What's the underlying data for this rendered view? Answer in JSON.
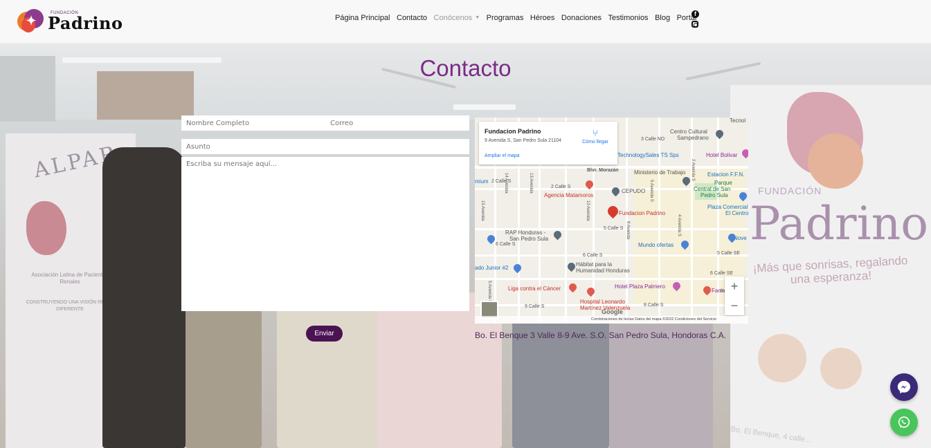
{
  "brand": {
    "small": "FUNDACIÓN",
    "name": "Padrino"
  },
  "nav": {
    "items": [
      {
        "label": "Página Principal",
        "muted": false
      },
      {
        "label": "Contacto",
        "muted": false
      },
      {
        "label": "Conócenos",
        "muted": true,
        "dropdown": true
      },
      {
        "label": "Programas",
        "muted": false
      },
      {
        "label": "Héroes",
        "muted": false
      },
      {
        "label": "Donaciones",
        "muted": false
      },
      {
        "label": "Testimonios",
        "muted": false
      },
      {
        "label": "Blog",
        "muted": false
      },
      {
        "label": "Portal",
        "muted": false
      }
    ],
    "social_icons": [
      "facebook-icon",
      "instagram-icon"
    ]
  },
  "page": {
    "title": "Contacto"
  },
  "form": {
    "name_placeholder": "Nombre Completo",
    "email_placeholder": "Correo",
    "subject_placeholder": "Asunto",
    "message_placeholder": "Escriba su mensaje aquí...",
    "submit_label": "Enviar"
  },
  "map": {
    "place_name": "Fundacion Padrino",
    "place_address": "9 Avenida S, San Pedro Sula 21104",
    "directions_label": "Cómo llegar",
    "enlarge_label": "Ampliar el mapa",
    "labels": {
      "tecnol": "Tecnol",
      "centro": "Centro Cultural",
      "sampedrano": "Sampedrano",
      "calle3": "3 Calle NO",
      "technology": "TechnologySales TS Sps",
      "hotel_bolivar": "Hotel Bolivar",
      "morazan": "Blvr. Morazán",
      "ministerio": "Ministerio de Trabajo",
      "estacion": "Estacion F.F.N.",
      "premium": "mium",
      "calle2a": "2 Calle S",
      "calle2b": "2 Calle S",
      "parque": "Parque",
      "central": "Central de San",
      "pedro": "Pedro Sula",
      "cepudo": "CEPUDO",
      "agencia": "Agencia Matamoros",
      "plaza": "Plaza Comercial",
      "elcentro": "El Centro",
      "fundacion": "Fundacion Padrino",
      "calle5": "5 Calle S",
      "rap": "RAP Honduras -",
      "rap2": "San Pedro Sula",
      "calle6a": "6 Calle S",
      "mundo": "Mundo ofertas",
      "nove": "Nove",
      "calle5se": "5 Calle SE",
      "calle6b": "6 Calle S",
      "junior": "ado Junior #2",
      "habitat": "Hábitat para la",
      "habitat2": "Humanidad Honduras",
      "calle6se": "6 Calle SE",
      "liga": "Liga contra el Cáncer",
      "hotelplaza": "Hotel Plaza Palmero",
      "farm": "Farm",
      "hospital": "Hospital Leonardo",
      "martinez": "Martínez Valenzuela",
      "calle9": "9 Calle S",
      "calle8": "8 Calle S",
      "av14": "14 Avenida",
      "av15": "15 Avenida",
      "av13": "13 Avenida",
      "av10": "10 Avenida",
      "av9": "9 Avenida",
      "av4": "4 Avenida S",
      "av5": "5 Avenida S",
      "av2": "2 Avenida S",
      "av5s": "5 Avenida S",
      "in": "in"
    },
    "attribution": "Combinaciones de teclas   Datos del mapa ©2022   Condiciones del Servicio",
    "google": "Google",
    "zoom_in": "+",
    "zoom_out": "−"
  },
  "address": "Bo. El Benque 3 Valle 8-9 Ave. S.O. San Pedro Sula, Hondoras C.A.",
  "background": {
    "alpar": "ALPAR",
    "alpar_arc": "Asociación Latina de Pacientes Renales",
    "alpar_sub": "CONSTRUYENDO UNA VISIÓN RENAL DIFERENTE",
    "banner_fund": "FUNDACIÓN",
    "banner_name": "Padrino",
    "banner_tagline": "¡Más que sonrisas, regalando una esperanza!",
    "banner_bottom": "Bo. El Benque, 4 calle..."
  },
  "colors": {
    "accent": "#7b2b86",
    "button": "#4a1352",
    "messenger": "#3b2a78",
    "whatsapp": "#49c55b"
  }
}
